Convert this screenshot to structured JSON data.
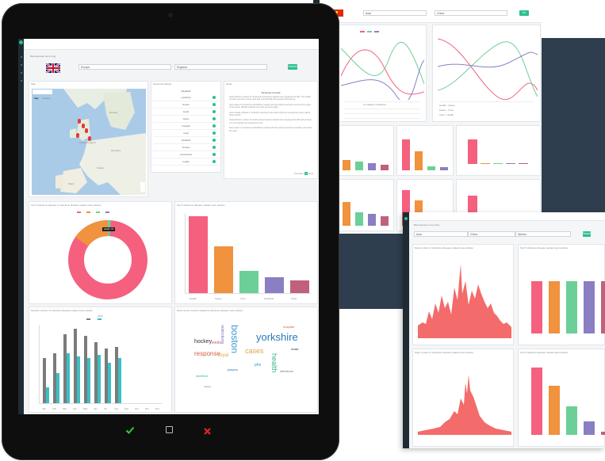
{
  "colors": {
    "pink": "#f5607f",
    "orange": "#f0923e",
    "green": "#6ccf97",
    "purple": "#8a7fc2",
    "mauve": "#c0607d",
    "red": "#f36b6b",
    "gray": "#7b7b7b",
    "teal": "#3bbfc4",
    "accent": "#2bbf8c",
    "navy": "#2e3e4e",
    "dark": "#1f2b33"
  },
  "tablet": {
    "header_title": "Bhuroadshow story blog",
    "region_select": "Europe",
    "country_select": "England",
    "go_button": "Search",
    "flag": "uk-flag-icon",
    "map_panel": {
      "title": "Map",
      "badge": "Info",
      "tabs": [
        "Map",
        "Satellite"
      ],
      "labels": [
        "Greenland",
        "Norway",
        "Sweden",
        "United Kingdom",
        "Germany",
        "France",
        "Spain",
        "Italy",
        "Portugal"
      ]
    },
    "keywords_panel": {
      "title": "Keywords Setting",
      "badge": "Edit",
      "header": "Keyword",
      "rows": [
        "yorkshire",
        "boston",
        "leeds",
        "cases",
        "hospital",
        "royal",
        "sheffield",
        "hockey",
        "manchester",
        "health"
      ]
    },
    "news_panel": {
      "title": "News",
      "heading": "Summary of news",
      "paragraphs": [
        "South Africa's number of confirmed coronavirus deaths has surpassed 10,000. The health minister says the country also has reached 500 000 people confirmed as.",
        "New cases of coronavirus identified in states with the peak of previous counts at the close of the week, officials said this as much as recent days.",
        "Some health officials in Yorkshire reported 1 the total confirmed coronavirus cases will be close shortly.",
        "South Africa's number of confirmed coronavirus deaths has surpassed 10,000 with at least 2 in the hospital and expected to rise.",
        "New cases of coronavirus identified in states with the peak of previous recording more than the rates."
      ],
      "pager_prev": "Previous",
      "pager_page": "1",
      "pager_next": "Next"
    },
    "donut_panel": {
      "title": "Top 5 Infectious disease in Infectious disease related news articles",
      "badge": "Info",
      "legend": [
        "Health",
        "Cases",
        "Virus",
        "Outbreak",
        "Other"
      ],
      "tooltip": "Health: 78"
    },
    "bar_panel": {
      "title": "Top 5 Infectious disease related news articles",
      "badge": "Info",
      "categories": [
        "Health",
        "Cases",
        "Virus",
        "Outbreak",
        "Other"
      ],
      "yticks": [
        "0",
        "100",
        "200",
        "300",
        "400"
      ]
    },
    "monthly_panel": {
      "title": "Monthly number of infectious disease related news articles",
      "badge": "Info",
      "chart_title": "2020",
      "legend": [
        "Total number",
        "Other disease"
      ],
      "months": [
        "Jan",
        "Feb",
        "Mar",
        "Apr",
        "May",
        "Jun",
        "Jul",
        "Aug",
        "Sep",
        "Oct",
        "Nov",
        "Dec"
      ]
    },
    "wordcloud_panel": {
      "title": "Word cloud of words related to infectious disease news articles",
      "badge": "Info",
      "words": [
        {
          "t": "yorkshire",
          "s": 13,
          "c": "#2a7ab8"
        },
        {
          "t": "boston",
          "s": 12,
          "c": "#3a9ad1"
        },
        {
          "t": "cases",
          "s": 9,
          "c": "#e0a64a"
        },
        {
          "t": "health",
          "s": 9,
          "c": "#3bb38a"
        },
        {
          "t": "response",
          "s": 8,
          "c": "#d0613f"
        },
        {
          "t": "hockey",
          "s": 7,
          "c": "#333333"
        },
        {
          "t": "royal",
          "s": 6,
          "c": "#e0a64a"
        },
        {
          "t": "restrictions",
          "s": 5,
          "c": "#7a6bb5"
        },
        {
          "t": "leeds",
          "s": 5,
          "c": "#c0607d"
        },
        {
          "t": "players",
          "s": 4,
          "c": "#2a7ab8"
        },
        {
          "t": "phe",
          "s": 5,
          "c": "#3a9ad1"
        },
        {
          "t": "infections",
          "s": 4,
          "c": "#6c7a85"
        },
        {
          "t": "sheffield",
          "s": 4,
          "c": "#2bbf8c"
        },
        {
          "t": "hospital",
          "s": 4,
          "c": "#d0613f"
        },
        {
          "t": "mask",
          "s": 4,
          "c": "#333333"
        },
        {
          "t": "testing",
          "s": 3,
          "c": "#7a6bb5"
        }
      ]
    },
    "footer_icons": [
      "checkmark-icon",
      "square-icon",
      "cross-icon"
    ]
  },
  "top_right": {
    "flag": "china-flag-icon",
    "region_select": "Asia",
    "country_select": "China",
    "go_button": "Go",
    "line_legend": [
      "Health",
      "Cases",
      "Virus"
    ],
    "table_headers": [
      "Type",
      "Num",
      "Correlation coefficient"
    ],
    "table_rows": [
      [
        "Health - Cases",
        "0.72"
      ],
      [
        "Cases - Virus",
        "0.65"
      ],
      [
        "Virus - Health",
        "0.48"
      ]
    ]
  },
  "bottom_right": {
    "header_title": "Bhuroadshow story blog",
    "region_select": "Asia",
    "country_select": "China",
    "city_select": "Wuhan",
    "go_button": "Search",
    "panel1_title": "Daily number of infectious disease related news articles",
    "panel2_title": "Top 5 infectious disease related news articles",
    "panel3_title": "Daily number of infectious disease related news articles",
    "panel4_title": "Top 5 infectious disease related news articles"
  }
}
